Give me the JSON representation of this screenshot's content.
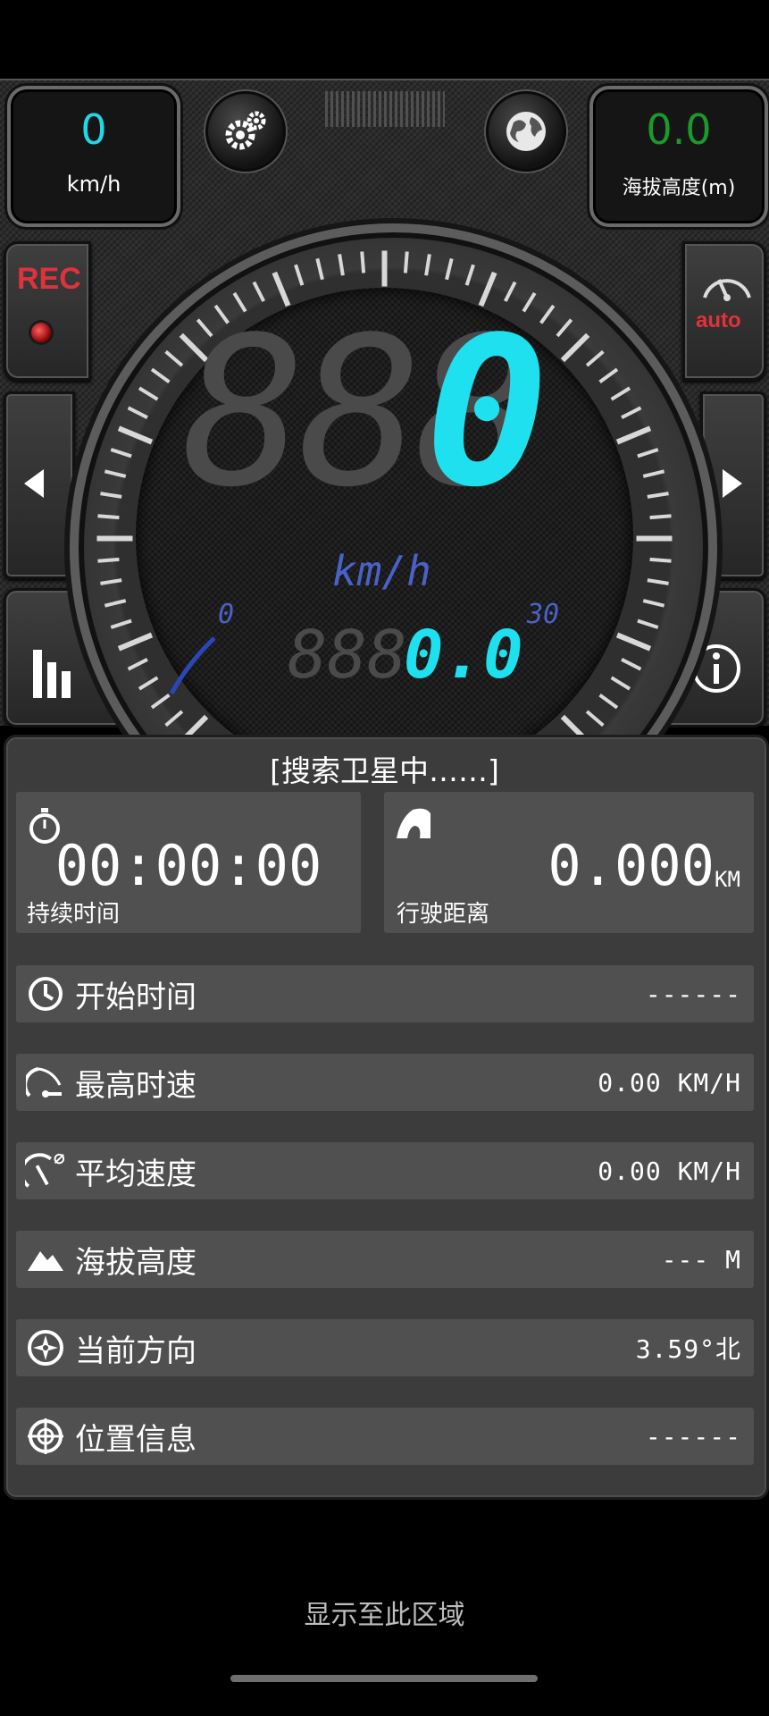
{
  "corner_readouts": {
    "speed": {
      "value": "0",
      "unit": "km/h"
    },
    "altitude": {
      "value": "0.0",
      "unit": "海拔高度(m)"
    }
  },
  "buttons": {
    "rec_label": "REC",
    "auto_label": "auto"
  },
  "dial": {
    "main_ghost": "888",
    "main_speed": "0",
    "unit": "km/h",
    "range_min": "0",
    "range_max": "30",
    "odo_ghost": "888",
    "odo_value": "0.0"
  },
  "status": "[搜索卫星中……]",
  "duration": {
    "value": "00:00:00",
    "label": "持续时间"
  },
  "distance": {
    "value": "0.000",
    "unit": "KM",
    "label": "行驶距离"
  },
  "stats": [
    {
      "label": "开始时间",
      "value": "------",
      "icon": "clock-icon"
    },
    {
      "label": "最高时速",
      "value": "0.00 KM/H",
      "icon": "max-speed-icon"
    },
    {
      "label": "平均速度",
      "value": "0.00 KM/H",
      "icon": "avg-speed-icon"
    },
    {
      "label": "海拔高度",
      "value": "--- M",
      "icon": "mountain-icon"
    },
    {
      "label": "当前方向",
      "value": "3.59°北",
      "icon": "compass-icon"
    },
    {
      "label": "位置信息",
      "value": "------",
      "icon": "crosshair-icon"
    }
  ],
  "footer": "显示至此区域",
  "colors": {
    "accent": "#22d6e6",
    "altitude_green": "#1a9a2a",
    "rec_red": "#e0323a",
    "unit_blue": "#4a62c8"
  }
}
